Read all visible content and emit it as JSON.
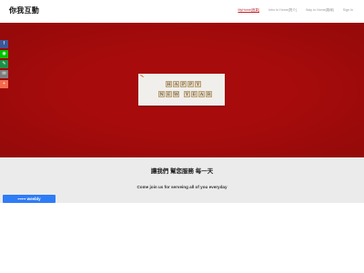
{
  "site": {
    "title": "你我互動"
  },
  "nav": {
    "items": [
      {
        "label": "MyHome[首頁]",
        "active": true
      },
      {
        "label": "Intro to Home[簡介]",
        "active": false
      },
      {
        "label": "Way to Home[路線]",
        "active": false
      },
      {
        "label": "Sign In",
        "active": false
      }
    ]
  },
  "hero": {
    "card_tiles": [
      "H",
      "A",
      "P",
      "P",
      "Y",
      "N",
      "E",
      "W",
      "Y",
      "E",
      "A",
      "R"
    ],
    "background_color": "#a80b0b"
  },
  "share": {
    "buttons": [
      {
        "icon": "facebook-icon",
        "color": "#3b5998",
        "glyph": "f"
      },
      {
        "icon": "line-icon",
        "color": "#00c300",
        "glyph": "◉"
      },
      {
        "icon": "link-icon",
        "color": "#1f8f4a",
        "glyph": "✎"
      },
      {
        "icon": "email-icon",
        "color": "#7f7f7f",
        "glyph": "✉"
      },
      {
        "icon": "plus-icon",
        "color": "#f36b4f",
        "glyph": "+"
      }
    ]
  },
  "section": {
    "title": "讓我們 幫您服務 每一天",
    "subtitle": "Come join us for serveing all of you everyday"
  },
  "badge": {
    "label": "⊶⊶ weebly"
  }
}
